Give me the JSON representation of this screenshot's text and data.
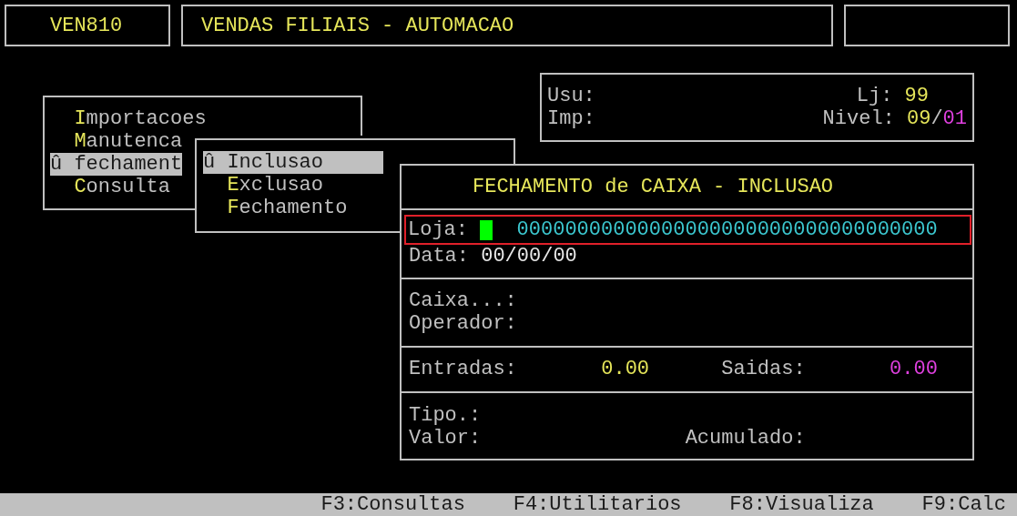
{
  "header": {
    "program_code": "VEN810",
    "title": "VENDAS FILIAIS - AUTOMACAO"
  },
  "user_panel": {
    "usu_label": "Usu:",
    "lj_label": "Lj:",
    "lj_value": "99",
    "imp_label": "Imp:",
    "nivel_label": "Nivel:",
    "nivel_value": "09",
    "nivel_separator": "/",
    "nivel_sub": "01"
  },
  "main_menu": [
    {
      "label": "Importacoes",
      "selected": false
    },
    {
      "label": "Manutenca",
      "selected": false
    },
    {
      "label": "û fechament",
      "selected": true
    },
    {
      "label": "Consulta",
      "selected": false
    }
  ],
  "sub_menu": [
    {
      "label": "û Inclusao",
      "selected": true
    },
    {
      "label": "Exclusao",
      "selected": false
    },
    {
      "label": "Fechamento",
      "selected": false
    }
  ],
  "form": {
    "title": "FECHAMENTO de CAIXA - INCLUSAO",
    "loja_label": "Loja:",
    "loja_value": "00000000000000000000000000000000000",
    "data_label": "Data:",
    "data_value": "00/00/00",
    "caixa_label": "Caixa...:",
    "operador_label": "Operador:",
    "totals": [
      {
        "label": "Entradas:",
        "value": "0.00",
        "color": "#e6e65a"
      },
      {
        "label": "Saidas:",
        "value": "0.00",
        "color": "#e040e0"
      }
    ],
    "tipo_label": "Tipo.:",
    "valor_label": "Valor:",
    "acumulado_label": "Acumulado:"
  },
  "function_keys": [
    "F3:Consultas",
    "F4:Utilitarios",
    "F8:Visualiza",
    "F9:Calc"
  ]
}
